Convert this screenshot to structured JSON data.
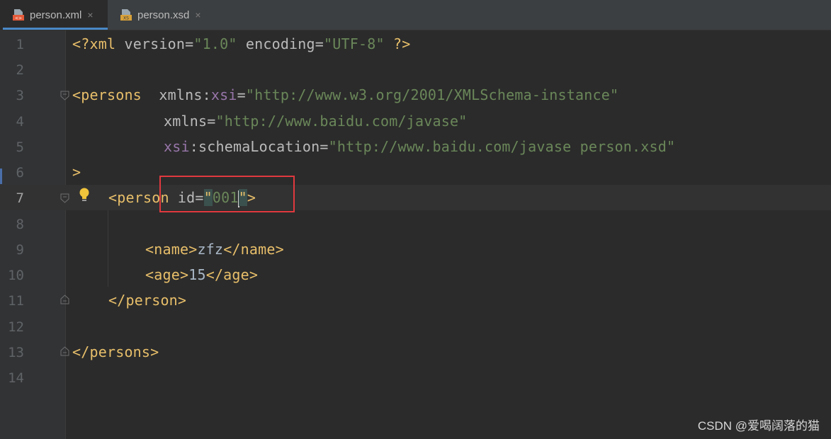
{
  "tabs": [
    {
      "label": "person.xml",
      "icon": "xml-file-icon",
      "active": true
    },
    {
      "label": "person.xsd",
      "icon": "xsd-file-icon",
      "active": false
    }
  ],
  "close_glyph": "×",
  "line_numbers": [
    "1",
    "2",
    "3",
    "4",
    "5",
    "6",
    "7",
    "8",
    "9",
    "10",
    "11",
    "12",
    "13",
    "14"
  ],
  "current_line": "7",
  "code": {
    "l1": {
      "open": "<?xml ",
      "a1": "version",
      "eq1": "=",
      "v1": "\"1.0\"",
      "a2": " encoding",
      "eq2": "=",
      "v2": "\"UTF-8\"",
      "close": " ?>"
    },
    "l3": {
      "open": "<persons",
      "sp": "  ",
      "a1": "xmlns",
      "colon": ":",
      "ns": "xsi",
      "eq": "=",
      "v": "\"http://www.w3.org/2001/XMLSchema-instance\""
    },
    "l4": {
      "a": "xmlns",
      "eq": "=",
      "v": "\"http://www.baidu.com/javase\""
    },
    "l5": {
      "ns": "xsi",
      "colon": ":",
      "a": "schemaLocation",
      "eq": "=",
      "v": "\"http://www.baidu.com/javase person.xsd\""
    },
    "l6": {
      "close": ">"
    },
    "l7": {
      "open": "<person",
      "a": " id",
      "eq": "=",
      "q1": "\"",
      "v": "001",
      "q2": "\"",
      "close": ">"
    },
    "l9": {
      "open": "<name>",
      "text": "zfz",
      "close": "</name>"
    },
    "l10": {
      "open": "<age>",
      "text": "15",
      "close": "</age>"
    },
    "l11": {
      "close": "</person>"
    },
    "l13": {
      "close": "</persons>"
    }
  },
  "watermark": "CSDN @爱喝阔落的猫",
  "colors": {
    "tag": "#e8bf6a",
    "attribute": "#bababa",
    "namespace": "#9876aa",
    "string": "#6a8759",
    "highlight_box": "#e0393e",
    "background": "#2b2b2b"
  }
}
